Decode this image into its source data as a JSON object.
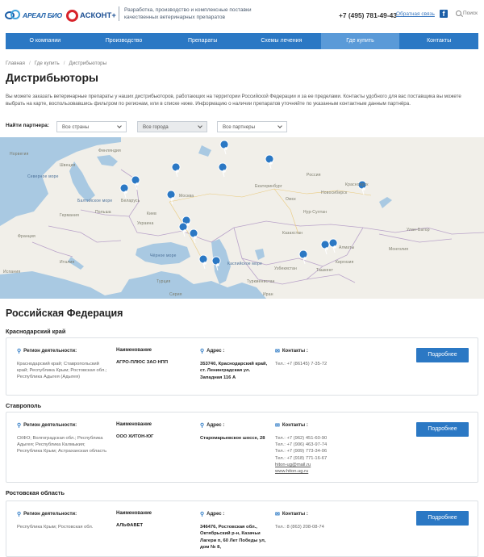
{
  "header": {
    "logo_areal": "АРЕАЛ БИО",
    "logo_askont": "АСКОНТ+",
    "tagline": "Разработка, производство и комплексные поставки качественных ветеринарных препаратов",
    "phone": "+7 (495) 781-49-43",
    "callback": "Обратная связь",
    "facebook": "f",
    "search": "Поиск"
  },
  "nav": [
    "О компании",
    "Производство",
    "Препараты",
    "Схемы лечения",
    "Где купить",
    "Контакты"
  ],
  "breadcrumb": [
    "Главная",
    "Где купить",
    "Дистрибьюторы"
  ],
  "page_title": "Дистрибьюторы",
  "intro": "Вы можете заказать ветеринарные препараты у наших дистрибьюторов, работающих на территории Российской Федерации и за ее пределами. Контакты удобного для вас поставщика вы можете выбрать на карте, воспользовавшись фильтром по регионам, или в списке ниже. Информацию о наличии препаратов уточняйте по указанным контактным данным партнёра.",
  "filter": {
    "label": "Найти партнера:",
    "country": "Все страны",
    "city": "Все города",
    "partner": "Все партнеры"
  },
  "map_labels": {
    "sea1": "Северное море",
    "sea2": "Балтийское море",
    "blacksea": "Чёрное море",
    "caspian": "Каспийское море",
    "russia": "Россия",
    "ukraine": "Украина",
    "belarus": "Беларусь",
    "kazakhstan": "Казахстан",
    "germany": "Германия",
    "poland": "Польша",
    "france": "Франция",
    "turkey": "Турция",
    "turkmenistan": "Туркменистан",
    "sweden": "Швеция",
    "finland": "Финляндия",
    "norway": "Норвегия",
    "italy": "Италия",
    "spain": "Испания",
    "iran": "Иран",
    "mongolia": "Монголия",
    "uzbekistan": "Узбекистан",
    "kyrgyzstan": "Киргизия",
    "syria": "Сирия",
    "tashkent": "Ташкент",
    "ekaterinburg": "Екатеринбург",
    "novosibirsk": "Новосибирск",
    "omsk": "Омск",
    "kiev": "Киев",
    "krasnoyarsk": "Красноярск",
    "nursultan": "Нур-Султан",
    "almaty": "Алматы",
    "ulaanbaatar": "Улан-Батор",
    "moscow": "Москва"
  },
  "section_title": "Российская Федерация",
  "col_titles": {
    "region": "Регион деятельности:",
    "name": "Наименование",
    "address": "Адрес :",
    "contacts": "Контакты :"
  },
  "button_label": "Подробнее",
  "partners": [
    {
      "region_title": "Краснодарский край",
      "region_text": "Краснодарский край; Ставропольский край; Республика Крым; Ростовская обл.; Республика Адыгея (Адыгея)",
      "name": "АГРО-ПЛЮС ЗАО НПП",
      "address": "353740, Краснодарский край, ст. Ленинградская ул. Западная 116 А",
      "contacts": [
        "Тел.: +7 (86145) 7-35-72"
      ]
    },
    {
      "region_title": "Ставрополь",
      "region_text": "СКФО; Волгоградская обл.; Республика Адыгея; Республика Калмыкия; Республика Крым; Астраханская область",
      "name": "ООО ХИТОН-ЮГ",
      "address": "Старомарьевское шоссе, 28",
      "contacts": [
        "Тел.: +7 (962) 451-60-90",
        "Тел.: +7 (906) 463-97-74",
        "Тел.: +7 (909) 773-34-06",
        "Тел.: +7 (918) 771-16-67",
        "hiton-ug@mail.ru",
        "www.hiton.ug.ru"
      ]
    },
    {
      "region_title": "Ростовская область",
      "region_text": "Республика Крым; Ростовская обл.",
      "name": "АЛЬФАВЕТ",
      "address": "346476, Ростовская обл., Октябрьский р-н, Казачьи Лагери п, 60 Лет Победы ул, дом № 8,",
      "contacts": [
        "Тел.: 8 (863) 208-08-74"
      ]
    }
  ]
}
